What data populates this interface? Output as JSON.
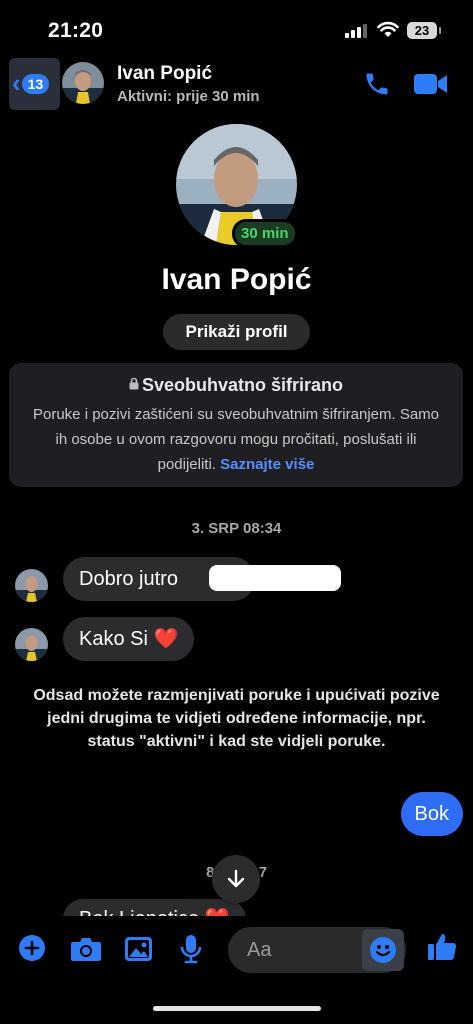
{
  "status_bar": {
    "time": "21:20",
    "battery": "23"
  },
  "header": {
    "back_count": "13",
    "name": "Ivan Popić",
    "status": "Aktivni: prije 30 min"
  },
  "profile": {
    "active_badge": "30 min",
    "name": "Ivan Popić",
    "view_profile_label": "Prikaži profil"
  },
  "e2ee": {
    "title": "Sveobuhvatno šifrirano",
    "body": "Poruke i pozivi zaštićeni su sveobuhvatnim šifriranjem. Samo ih osobe u ovom razgovoru mogu pročitati, poslušati ili podijeliti.",
    "link": "Saznajte više"
  },
  "thread": {
    "timestamp_1": "3. SRP 08:34",
    "msg_1": "Dobro jutro",
    "msg_2": "Kako Si",
    "notice": "Odsad možete razmjenjivati poruke i upućivati pozive jedni drugima te vidjeti određene informacije, npr. status \"aktivni\" i kad ste vidjeli poruke.",
    "msg_out_1": "Bok",
    "timestamp_2": "8. S   3:37",
    "msg_3_partial": "Bok Lienotice"
  },
  "composer": {
    "placeholder": "Aa"
  },
  "colors": {
    "accent": "#2e7cf6",
    "bubble_out": "#2e6df6",
    "bubble_in": "#2c2c2e",
    "active_green": "#4ad66d"
  }
}
